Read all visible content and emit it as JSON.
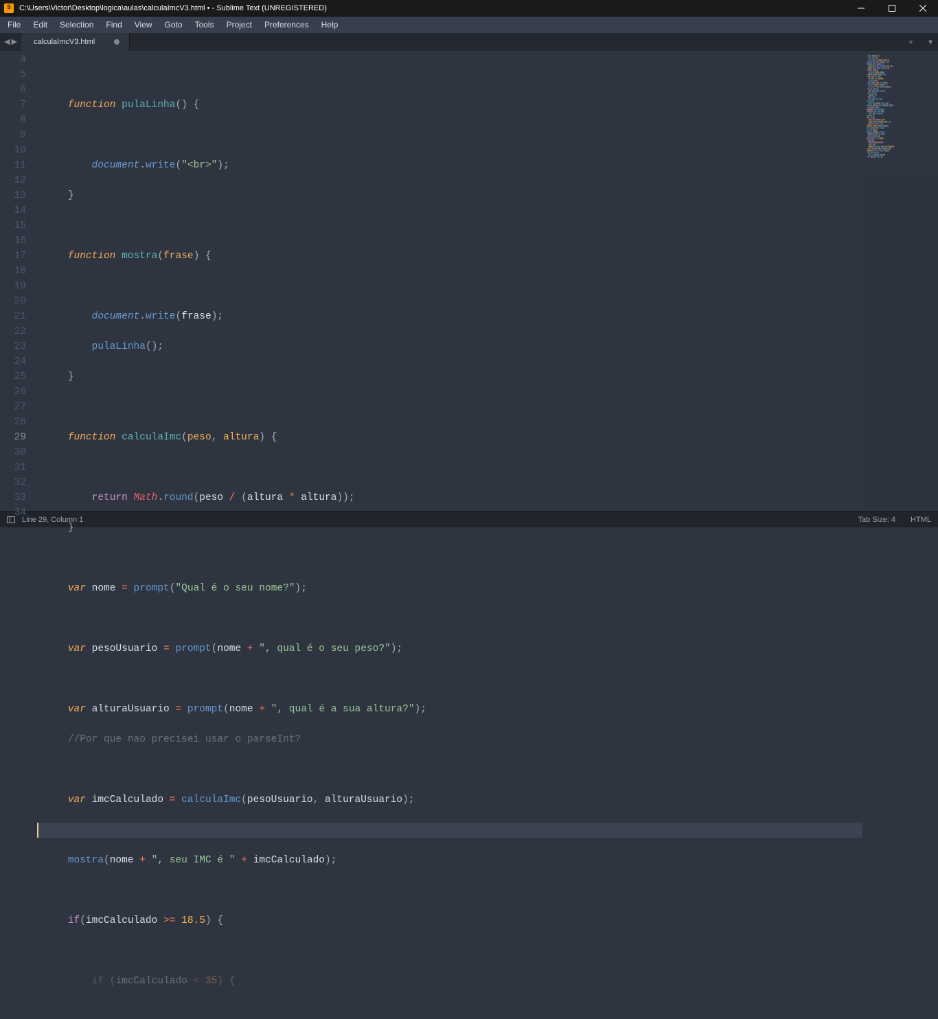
{
  "window": {
    "title": "C:\\Users\\Victor\\Desktop\\logica\\aulas\\calculaImcV3.html • - Sublime Text (UNREGISTERED)"
  },
  "menu": {
    "items": [
      "File",
      "Edit",
      "Selection",
      "Find",
      "View",
      "Goto",
      "Tools",
      "Project",
      "Preferences",
      "Help"
    ]
  },
  "tabs": {
    "active": "calculaImcV3.html",
    "add_label": "+",
    "dropdown_label": "▾"
  },
  "gutter": {
    "start": 4,
    "end": 34,
    "active": 29
  },
  "code": {
    "l4": "",
    "l5_fn": "function ",
    "l5_name": "pulaLinha",
    "l5_p1": "(",
    "l5_p2": ")",
    "l5_sp": " ",
    "l5_b": "{",
    "l7_doc": "document",
    "l7_dot": ".",
    "l7_write": "write",
    "l7_p1": "(",
    "l7_str": "\"<br>\"",
    "l7_p2": ")",
    "l7_sc": ";",
    "l8_b": "}",
    "l10_fn": "function ",
    "l10_name": "mostra",
    "l10_p1": "(",
    "l10_param": "frase",
    "l10_p2": ")",
    "l10_sp": " ",
    "l10_b": "{",
    "l12_doc": "document",
    "l12_dot": ".",
    "l12_write": "write",
    "l12_p1": "(",
    "l12_arg": "frase",
    "l12_p2": ")",
    "l12_sc": ";",
    "l13_fn": "pulaLinha",
    "l13_p1": "(",
    "l13_p2": ")",
    "l13_sc": ";",
    "l14_b": "}",
    "l16_fn": "function ",
    "l16_name": "calculaImc",
    "l16_p1": "(",
    "l16_a": "peso",
    "l16_c": ", ",
    "l16_b2": "altura",
    "l16_p2": ")",
    "l16_sp": " ",
    "l16_bo": "{",
    "l18_ret": "return ",
    "l18_math": "Math",
    "l18_dot": ".",
    "l18_round": "round",
    "l18_p1": "(",
    "l18_peso": "peso ",
    "l18_div": "/ ",
    "l18_p2": "(",
    "l18_alt1": "altura ",
    "l18_mul": "* ",
    "l18_alt2": "altura",
    "l18_p3": ")",
    "l18_p4": ")",
    "l18_sc": ";",
    "l19_b": "}",
    "l21_var": "var ",
    "l21_name": "nome ",
    "l21_eq": "= ",
    "l21_fn": "prompt",
    "l21_p1": "(",
    "l21_str": "\"Qual é o seu nome?\"",
    "l21_p2": ")",
    "l21_sc": ";",
    "l23_var": "var ",
    "l23_name": "pesoUsuario ",
    "l23_eq": "= ",
    "l23_fn": "prompt",
    "l23_p1": "(",
    "l23_arg": "nome ",
    "l23_plus": "+ ",
    "l23_str": "\", qual é o seu peso?\"",
    "l23_p2": ")",
    "l23_sc": ";",
    "l25_var": "var ",
    "l25_name": "alturaUsuario ",
    "l25_eq": "= ",
    "l25_fn": "prompt",
    "l25_p1": "(",
    "l25_arg": "nome ",
    "l25_plus": "+ ",
    "l25_str": "\", qual é a sua altura?\"",
    "l25_p2": ")",
    "l25_sc": ";",
    "l26_cmt": "//Por que nao precisei usar o parseInt?",
    "l28_var": "var ",
    "l28_name": "imcCalculado ",
    "l28_eq": "= ",
    "l28_fn": "calculaImc",
    "l28_p1": "(",
    "l28_a": "pesoUsuario",
    "l28_c": ", ",
    "l28_b": "alturaUsuario",
    "l28_p2": ")",
    "l28_sc": ";",
    "l30_fn": "mostra",
    "l30_p1": "(",
    "l30_arg": "nome ",
    "l30_plus": "+ ",
    "l30_str": "\", seu IMC é \"",
    "l30_plus2": " + ",
    "l30_arg2": "imcCalculado",
    "l30_p2": ")",
    "l30_sc": ";",
    "l32_if": "if",
    "l32_p1": "(",
    "l32_var": "imcCalculado ",
    "l32_op": ">= ",
    "l32_num": "18.5",
    "l32_p2": ")",
    "l32_sp": " ",
    "l32_b": "{",
    "l34_pre": "        ",
    "l34_if": "if ",
    "l34_p1": "(",
    "l34_var": "imcCalculado ",
    "l34_op": "< ",
    "l34_num": "35",
    "l34_p2": ")",
    "l34_sp": " ",
    "l34_b": "{"
  },
  "status": {
    "position": "Line 29, Column 1",
    "tab_size": "Tab Size: 4",
    "syntax": "HTML"
  }
}
